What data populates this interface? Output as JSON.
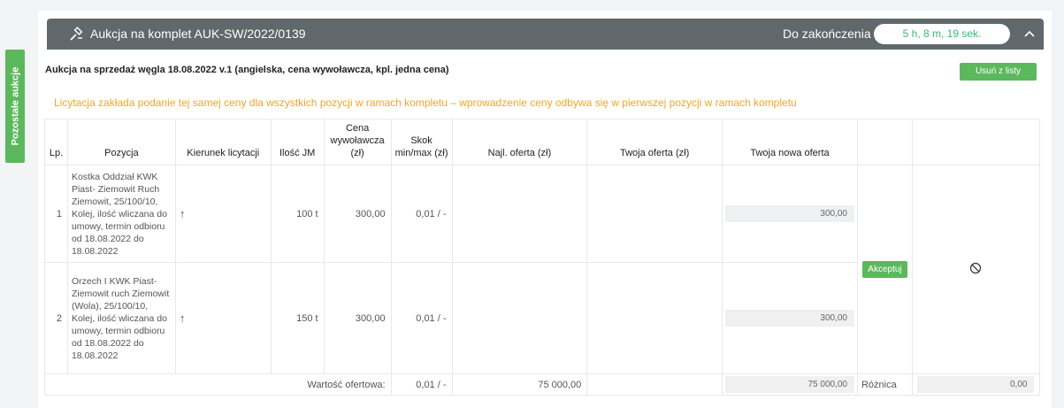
{
  "side_tab": {
    "label": "Pozostałe aukcje"
  },
  "header": {
    "title": "Aukcja na komplet AUK-SW/2022/0139",
    "end_label": "Do zakończenia",
    "timer": "5 h, 8 m, 19 sek."
  },
  "auction": {
    "title": "Aukcja na sprzedaż węgla 18.08.2022 v.1 (angielska, cena wywoławcza, kpl. jedna cena)",
    "remove_label": "Usuń z listy",
    "note": "Licytacja zakłada podanie tej samej ceny dla wszystkich pozycji w ramach kompletu – wprowadzenie ceny odbywa się w pierwszej pozycji w ramach kompletu"
  },
  "table": {
    "headers": {
      "lp": "Lp.",
      "pozycja": "Pozycja",
      "kierunek": "Kierunek licytacji",
      "ilosc": "Ilość JM",
      "cena": "Cena wywoławcza (zł)",
      "skok": "Skok min/max (zł)",
      "najl": "Najl. oferta (zł)",
      "twoja": "Twoja oferta (zł)",
      "nowa": "Twoja nowa oferta"
    },
    "rows": [
      {
        "lp": "1",
        "pozycja": "Kostka Oddział KWK Piast- Ziemowit Ruch Ziemowit, 25/100/10, Kolej, ilość wliczana do umowy, termin odbioru od 18.08.2022 do 18.08.2022",
        "kierunek": "↑",
        "ilosc": "100 t",
        "cena": "300,00",
        "skok": "0,01 / -",
        "nowa": "300,00"
      },
      {
        "lp": "2",
        "pozycja": "Orzech I KWK Piast- Ziemowit ruch Ziemowit (Wola), 25/100/10, Kolej, ilość wliczana do umowy, termin odbioru od 18.08.2022 do 18.08.2022",
        "kierunek": "↑",
        "ilosc": "150 t",
        "cena": "300,00",
        "skok": "0,01 / -",
        "nowa": "300,00"
      }
    ],
    "accept_label": "Akceptuj",
    "footer": {
      "wartosc_label": "Wartość ofertowa:",
      "skok": "0,01 / -",
      "najl": "75 000,00",
      "nowa": "75 000,00",
      "roznica_label": "Różnica",
      "roznica": "0,00"
    }
  },
  "colors": {
    "accent": "#5cb85c",
    "header_bg": "#60686b",
    "warning": "#f4a623",
    "negative": "#e57373"
  }
}
